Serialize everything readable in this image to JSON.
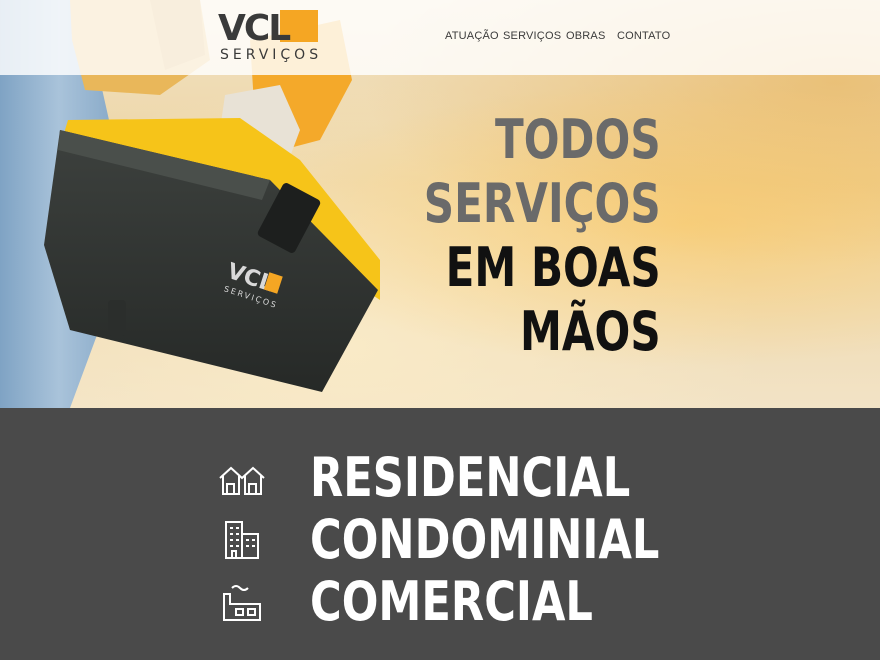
{
  "brand": {
    "logo_mark": "VCL",
    "logo_sub": "SERVIÇOS",
    "accent_color": "#f5a623",
    "dark_color": "#3a3a3a"
  },
  "nav": {
    "items": [
      "ATUAÇÃO",
      "SERVIÇOS",
      "OBRAS",
      "CONTATO"
    ]
  },
  "hero": {
    "headline_gray": [
      "TODOS",
      "SERVIÇOS"
    ],
    "headline_dark": [
      "EM BOAS",
      "MÃOS"
    ],
    "toolbox_logo": "VCL",
    "toolbox_logo_sub": "SERVIÇOS"
  },
  "sectors": [
    {
      "label": "RESIDENCIAL",
      "icon": "houses-icon"
    },
    {
      "label": "CONDOMINIAL",
      "icon": "buildings-icon"
    },
    {
      "label": "COMERCIAL",
      "icon": "factory-icon"
    }
  ]
}
